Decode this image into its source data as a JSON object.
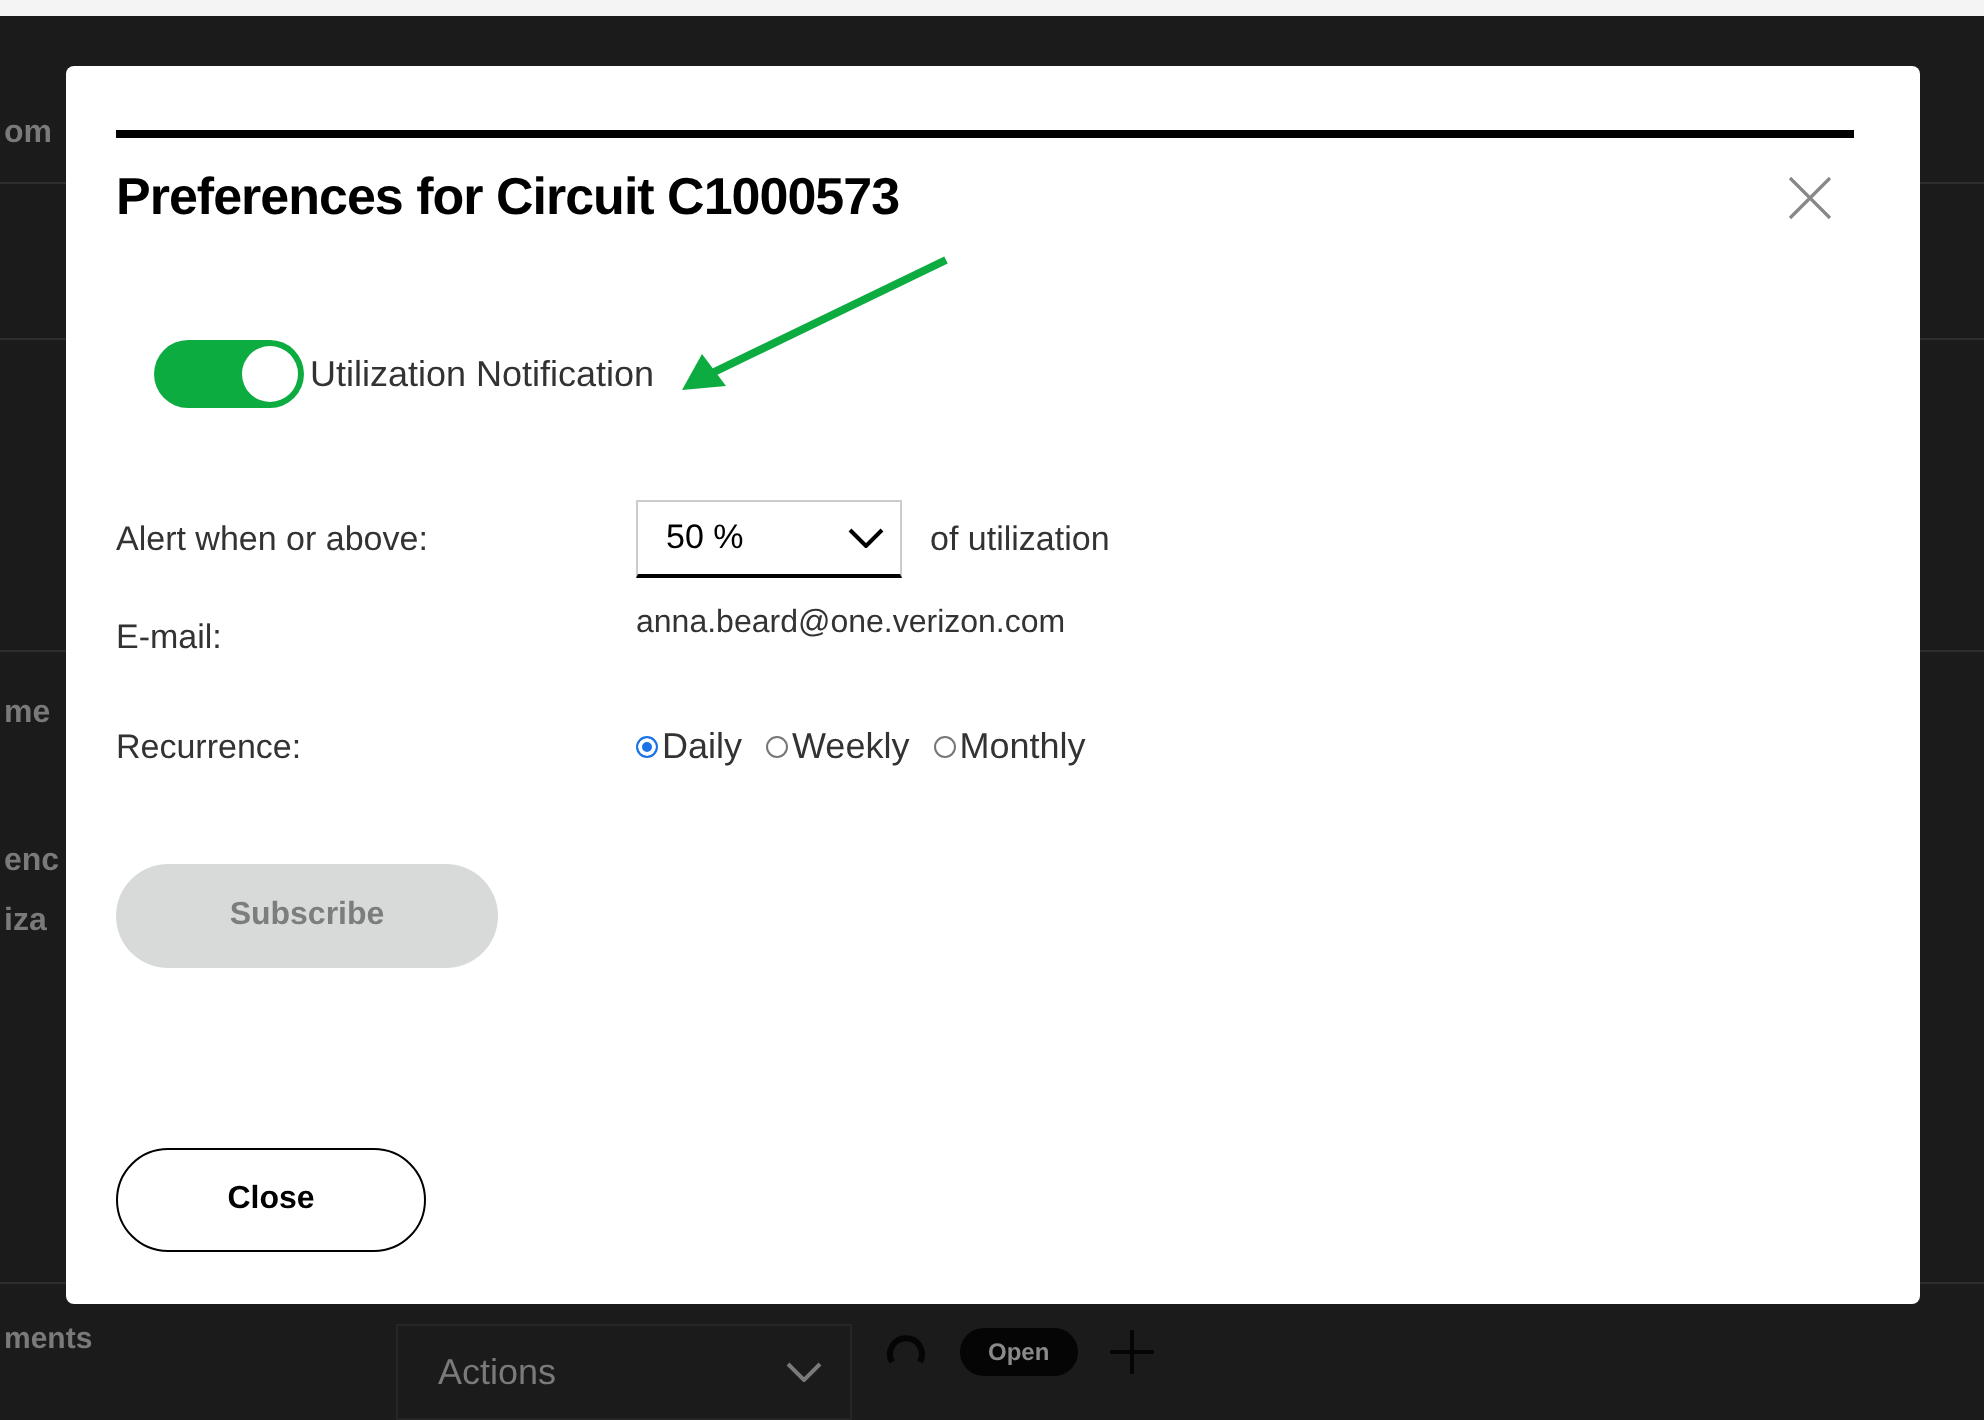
{
  "background": {
    "fragments": [
      "om",
      "me",
      "enc",
      "iza"
    ],
    "footer": {
      "label": "ments",
      "actions": "Actions",
      "status": "Open"
    }
  },
  "dialog": {
    "title": "Preferences for Circuit C1000573",
    "toggle": {
      "label": "Utilization Notification",
      "on": true
    },
    "alert": {
      "label": "Alert when or above:",
      "value": "50 %",
      "suffix": "of utilization"
    },
    "email": {
      "label": "E-mail:",
      "value": "anna.beard@one.verizon.com"
    },
    "recurrence": {
      "label": "Recurrence:",
      "options": [
        {
          "label": "Daily",
          "selected": true
        },
        {
          "label": "Weekly",
          "selected": false
        },
        {
          "label": "Monthly",
          "selected": false
        }
      ]
    },
    "subscribe": {
      "label": "Subscribe",
      "disabled": true
    },
    "close_button": "Close"
  }
}
